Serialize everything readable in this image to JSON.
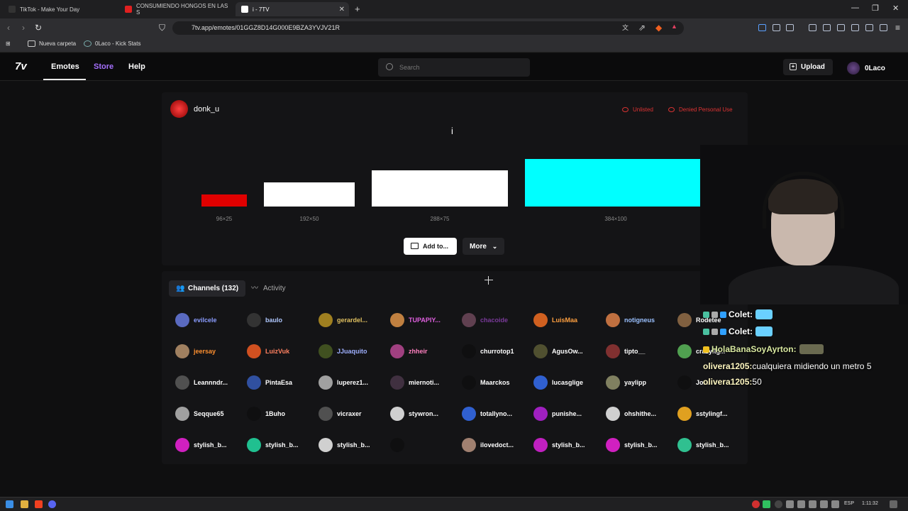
{
  "browser": {
    "tabs": [
      {
        "title": "TikTok - Make Your Day",
        "color": "#333333"
      },
      {
        "title": "CONSUMIENDO HONGOS EN LAS S",
        "color": "#e02020"
      },
      {
        "title": "i - 7TV",
        "color": "#ffffff"
      }
    ],
    "url": "7tv.app/emotes/01GGZ8D14G000E9BZA3YVJV21R",
    "bookmarks": [
      "Nueva carpeta",
      "0Laco - Kick Stats"
    ]
  },
  "site": {
    "logo": "7v",
    "nav": [
      "Emotes",
      "Store",
      "Help"
    ],
    "search_placeholder": "Search",
    "upload_label": "Upload",
    "username": "0Laco"
  },
  "emote": {
    "owner": "donk_u",
    "name": "i",
    "flags": [
      "Unlisted",
      "Denied Personal Use"
    ],
    "sizes": [
      {
        "label": "96×25",
        "color": "#e00000"
      },
      {
        "label": "192×50",
        "color": "#ffffff"
      },
      {
        "label": "288×75",
        "color": "#ffffff"
      },
      {
        "label": "384×100",
        "color": "#00ffff"
      }
    ],
    "add_label": "Add to...",
    "more_label": "More"
  },
  "tabs": {
    "channels": "Channels (132)",
    "activity": "Activity"
  },
  "channels": [
    [
      {
        "n": "evilcele",
        "c": "#8a9cff",
        "a": "#5a6ac0"
      },
      {
        "n": "baulo",
        "c": "#b0c8ff",
        "a": "#333"
      },
      {
        "n": "gerardel...",
        "c": "#e0c060",
        "a": "#a08020"
      },
      {
        "n": "TUPAPIY...",
        "c": "#e060e0",
        "a": "#c08040"
      },
      {
        "n": "chacoide",
        "c": "#7a3a9a",
        "a": "#604050"
      },
      {
        "n": "LuisMaa",
        "c": "#ffa040",
        "a": "#d06020"
      },
      {
        "n": "notigneus",
        "c": "#9ac0ff",
        "a": "#c07040"
      },
      {
        "n": "Rodetee",
        "c": "#ffffff",
        "a": "#806040"
      }
    ],
    [
      {
        "n": "jeersay",
        "c": "#ff9030",
        "a": "#a08060"
      },
      {
        "n": "LuizVuk",
        "c": "#ff8060",
        "a": "#d05020"
      },
      {
        "n": "JJuaquito",
        "c": "#9fb0ff",
        "a": "#405020"
      },
      {
        "n": "zhheir",
        "c": "#ff80c0",
        "a": "#a04080"
      },
      {
        "n": "churrotop1",
        "c": "#ffffff",
        "a": "#0f0f10"
      },
      {
        "n": "AgusOw...",
        "c": "#ffffff",
        "a": "#505030"
      },
      {
        "n": "tipto__",
        "c": "#ffffff",
        "a": "#803030"
      },
      {
        "n": "crazyitg...",
        "c": "#ffffff",
        "a": "#50a050"
      }
    ],
    [
      {
        "n": "Leannndr...",
        "c": "#ffffff",
        "a": "#505050"
      },
      {
        "n": "PintaEsa",
        "c": "#ffffff",
        "a": "#3050a0"
      },
      {
        "n": "luperez1...",
        "c": "#ffffff",
        "a": "#a0a0a0"
      },
      {
        "n": "miernoti...",
        "c": "#ffffff",
        "a": "#403040"
      },
      {
        "n": "Maarckos",
        "c": "#ffffff",
        "a": "#0f0f10"
      },
      {
        "n": "lucasglige",
        "c": "#ffffff",
        "a": "#3060d0"
      },
      {
        "n": "yaylipp",
        "c": "#ffffff",
        "a": "#808060"
      },
      {
        "n": "Jo...",
        "c": "#ffffff",
        "a": "#0f0f10"
      }
    ],
    [
      {
        "n": "Seqque65",
        "c": "#ffffff",
        "a": "#a0a0a0"
      },
      {
        "n": "1Buho",
        "c": "#ffffff",
        "a": "#0f0f10"
      },
      {
        "n": "vicraxer",
        "c": "#ffffff",
        "a": "#505050"
      },
      {
        "n": "stywron...",
        "c": "#ffffff",
        "a": "#d0d0d0"
      },
      {
        "n": "totallyno...",
        "c": "#ffffff",
        "a": "#3060d0"
      },
      {
        "n": "punishe...",
        "c": "#ffffff",
        "a": "#a020c0"
      },
      {
        "n": "ohshithe...",
        "c": "#ffffff",
        "a": "#d0d0d0"
      },
      {
        "n": "sstylingf...",
        "c": "#ffffff",
        "a": "#e0a020"
      }
    ],
    [
      {
        "n": "stylish_b...",
        "c": "#ffffff",
        "a": "#d020c0"
      },
      {
        "n": "stylish_b...",
        "c": "#ffffff",
        "a": "#20c090"
      },
      {
        "n": "stylish_b...",
        "c": "#ffffff",
        "a": "#d0d0d0"
      },
      {
        "n": "",
        "c": "#ffffff",
        "a": "#0f0f10"
      },
      {
        "n": "ilovedoct...",
        "c": "#ffffff",
        "a": "#a08070"
      },
      {
        "n": "stylish_b...",
        "c": "#ffffff",
        "a": "#c020c0"
      },
      {
        "n": "stylish_b...",
        "c": "#ffffff",
        "a": "#d020c0"
      },
      {
        "n": "stylish_b...",
        "c": "#ffffff",
        "a": "#30c090"
      }
    ]
  ],
  "chat": [
    {
      "user": "Colet:",
      "msg": ""
    },
    {
      "user": "Colet:",
      "msg": ""
    },
    {
      "user": "HolaBanaSoyAyrton:",
      "msg": ""
    },
    {
      "user": "olivera1205:",
      "msg": " cualquiera midiendo un metro 5"
    },
    {
      "user": "olivera1205:",
      "msg": " 50"
    }
  ],
  "taskbar": {
    "lang": "ESP",
    "time": "1:11:32"
  }
}
